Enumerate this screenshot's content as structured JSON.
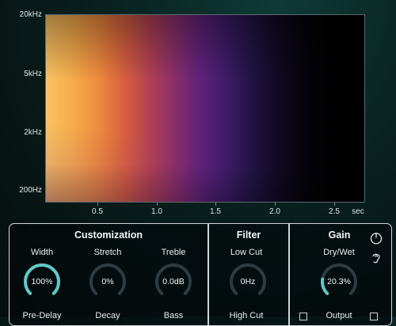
{
  "spectrogram": {
    "y_labels": [
      "20kHz",
      "5kHz",
      "2kHz",
      "200Hz"
    ],
    "x_labels": [
      "0.5",
      "1.0",
      "1.5",
      "2.0",
      "2.5"
    ],
    "x_unit": "sec"
  },
  "sections": {
    "customization": "Customization",
    "filter": "Filter",
    "gain": "Gain"
  },
  "knobs": {
    "width": {
      "label": "Width",
      "value": "100%",
      "level": 1.0
    },
    "stretch": {
      "label": "Stretch",
      "value": "0%",
      "level": 0.0
    },
    "treble": {
      "label": "Treble",
      "value": "0.0dB",
      "level": 0.0
    },
    "low_cut": {
      "label": "Low Cut",
      "value": "0Hz",
      "level": 0.0
    },
    "dry_wet": {
      "label": "Dry/Wet",
      "value": "20.3%",
      "level": 0.2
    }
  },
  "labels_row2": {
    "pre_delay": "Pre-Delay",
    "decay": "Decay",
    "bass": "Bass",
    "high_cut": "High Cut",
    "output": "Output"
  },
  "colors": {
    "accent": "#5fc9c4",
    "track": "#2e3b40"
  },
  "icons": [
    "power-icon",
    "ear-icon"
  ]
}
